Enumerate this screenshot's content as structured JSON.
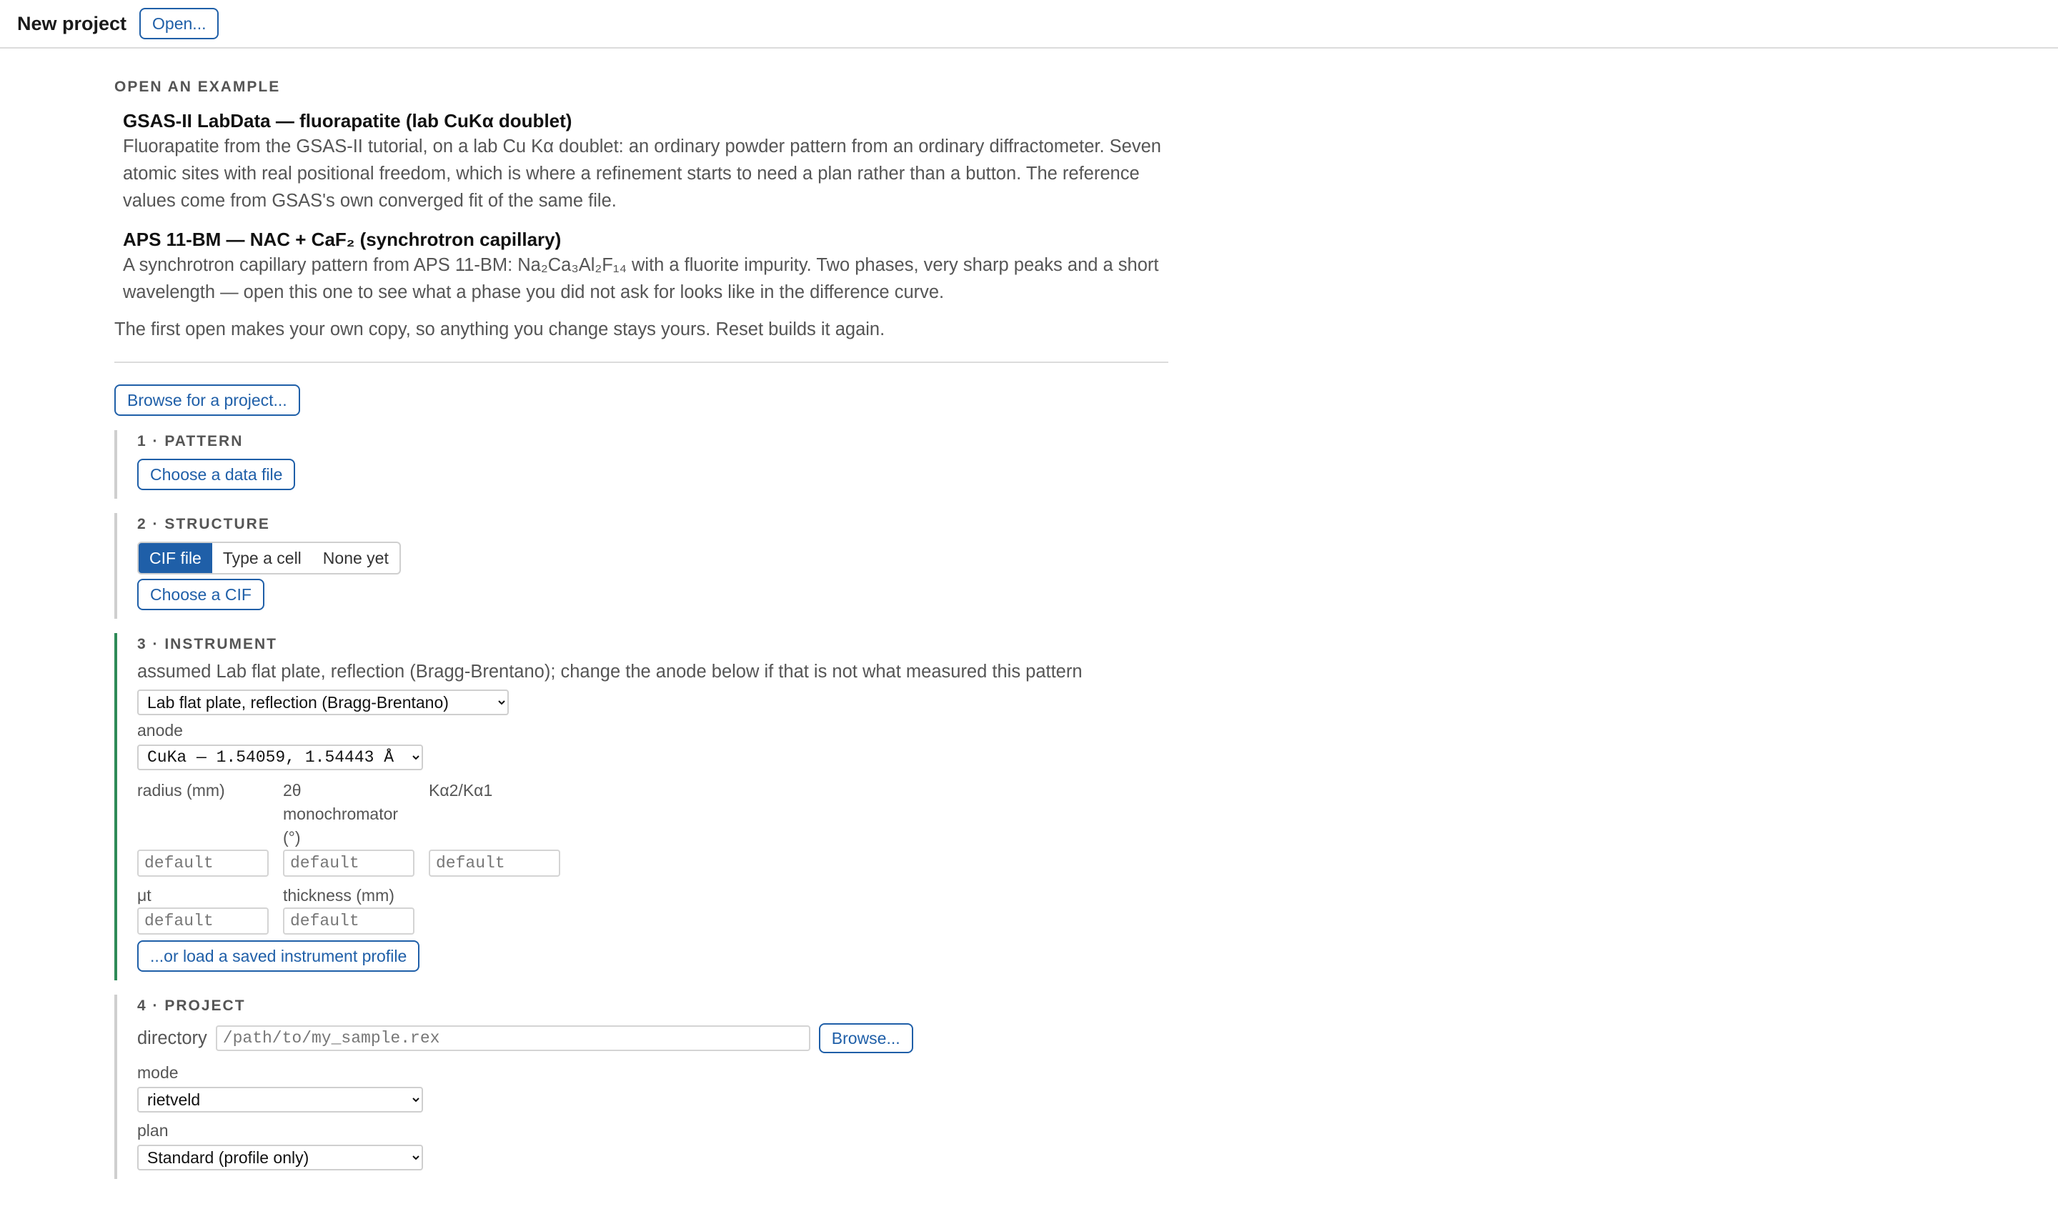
{
  "header": {
    "title": "New project",
    "open_label": "Open..."
  },
  "examples": {
    "heading": "OPEN AN EXAMPLE",
    "items": [
      {
        "title": "GSAS-II LabData — fluorapatite (lab CuKα doublet)",
        "description": "Fluorapatite from the GSAS-II tutorial, on a lab Cu Kα doublet: an ordinary powder pattern from an ordinary diffractometer. Seven atomic sites with real positional freedom, which is where a refinement starts to need a plan rather than a button. The reference values come from GSAS's own converged fit of the same file."
      },
      {
        "title": "APS 11-BM — NAC + CaF₂ (synchrotron capillary)",
        "description": "A synchrotron capillary pattern from APS 11-BM: Na₂Ca₃Al₂F₁₄ with a fluorite impurity. Two phases, very sharp peaks and a short wavelength — open this one to see what a phase you did not ask for looks like in the difference curve."
      }
    ],
    "note": "The first open makes your own copy, so anything you change stays yours. Reset builds it again."
  },
  "browse_label": "Browse for a project...",
  "pattern": {
    "heading": "1 · PATTERN",
    "button": "Choose a data file"
  },
  "structure": {
    "heading": "2 · STRUCTURE",
    "segments": [
      "CIF file",
      "Type a cell",
      "None yet"
    ],
    "selected": "CIF file",
    "button": "Choose a CIF"
  },
  "instrument": {
    "heading": "3 · INSTRUMENT",
    "assumed_text": "assumed Lab flat plate, reflection (Bragg-Brentano); change the anode below if that is not what measured this pattern",
    "geometry_value": "Lab flat plate, reflection (Bragg-Brentano)",
    "anode_label": "anode",
    "anode_value": "CuKa — 1.54059, 1.54443 Å",
    "fields": [
      {
        "label": "radius (mm)",
        "placeholder": "default"
      },
      {
        "label": "2θ monochromator (°)",
        "placeholder": "default"
      },
      {
        "label": "Kα2/Kα1",
        "placeholder": "default"
      },
      {
        "label": "μt",
        "placeholder": "default"
      },
      {
        "label": "thickness (mm)",
        "placeholder": "default"
      }
    ],
    "load_profile": "...or load a saved instrument profile"
  },
  "project": {
    "heading": "4 · PROJECT",
    "directory_label": "directory",
    "directory_placeholder": "/path/to/my_sample.rex",
    "browse_label": "Browse...",
    "mode_label": "mode",
    "mode_value": "rietveld",
    "plan_label": "plan",
    "plan_value": "Standard (profile only)"
  },
  "colors": {
    "accent": "#1f5fa8",
    "active_border": "#2e8a57",
    "divider": "#dcdcdc"
  }
}
